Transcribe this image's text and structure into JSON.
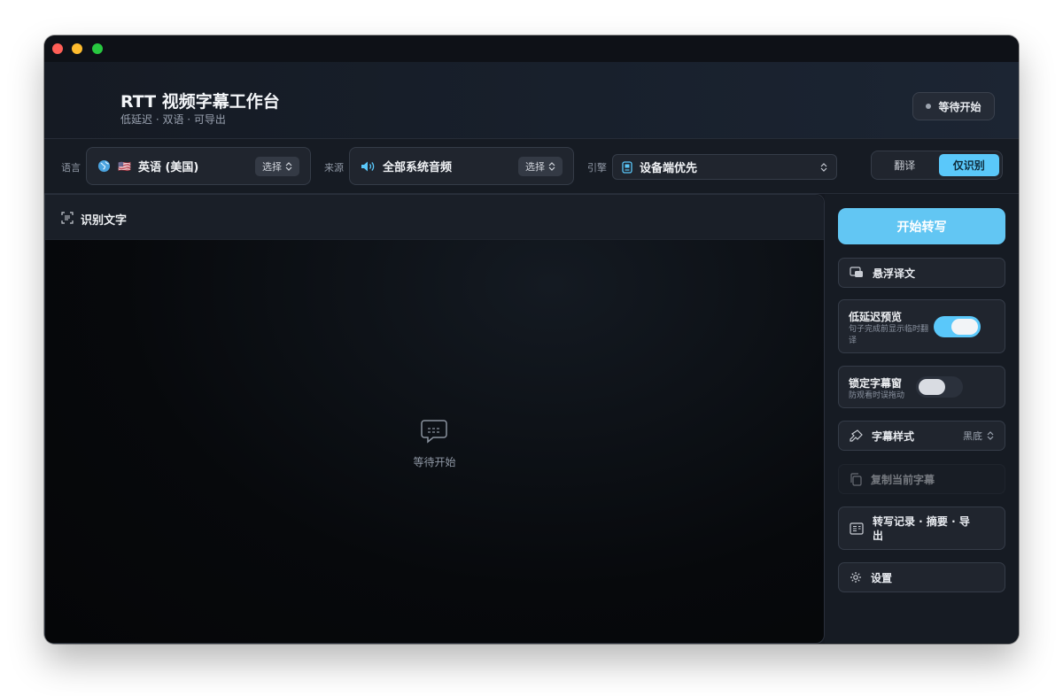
{
  "window": {
    "controls": [
      "close",
      "minimize",
      "zoom"
    ]
  },
  "header": {
    "title": "RTT 视频字幕工作台",
    "subtitle": "低延迟 · 双语 · 可导出",
    "status_label": "等待开始"
  },
  "toolbar": {
    "language_label": "语言",
    "language_flag": "🇺🇸",
    "language_value": "英语 (美国)",
    "language_pick": "选择",
    "source_label": "来源",
    "source_value": "全部系统音频",
    "source_pick": "选择",
    "engine_label": "引擎",
    "engine_value": "设备端优先",
    "mode_options": [
      "翻译",
      "仅识别"
    ],
    "mode_selected": "仅识别"
  },
  "main": {
    "panel_title": "识别文字",
    "empty_text": "等待开始"
  },
  "sidebar": {
    "start_button": "开始转写",
    "float_translation": "悬浮译文",
    "low_latency": {
      "title": "低延迟预览",
      "desc": "句子完成前显示临时翻译",
      "enabled": true
    },
    "lock_window": {
      "title": "锁定字幕窗",
      "desc": "防观看时误拖动",
      "enabled": false
    },
    "subtitle_style": {
      "label": "字幕样式",
      "value": "黑底"
    },
    "copy_subtitle": "复制当前字幕",
    "transcript_export": "转写记录 · 摘要 · 导出",
    "settings": "设置"
  },
  "colors": {
    "accent": "#5ac8fa",
    "background": "#141820",
    "panel": "#20252e"
  }
}
